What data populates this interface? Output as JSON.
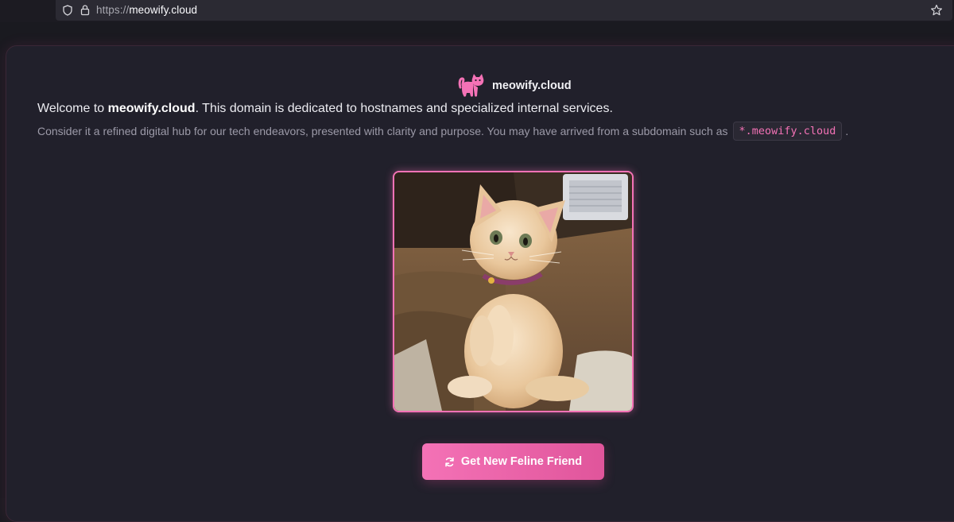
{
  "browser": {
    "url_protocol": "https://",
    "url_host": "meowify.cloud",
    "icons": [
      "shield-icon",
      "lock-icon",
      "star-icon"
    ]
  },
  "brand": {
    "name": "meowify.cloud",
    "icon": "cat-icon",
    "accent_color": "#f472b6"
  },
  "intro": {
    "welcome_prefix": "Welcome to ",
    "welcome_domain": "meowify.cloud",
    "welcome_suffix": ". This domain is dedicated to hostnames and specialized internal services.",
    "subtext_before": "Consider it a refined digital hub for our tech endeavors, presented with clarity and purpose. You may have arrived from a subdomain such as",
    "subdomain_example": "*.meowify.cloud",
    "subtext_after": "."
  },
  "photo": {
    "subject": "kitten-image"
  },
  "cta": {
    "label": "Get New Feline Friend",
    "icon": "refresh-icon"
  }
}
